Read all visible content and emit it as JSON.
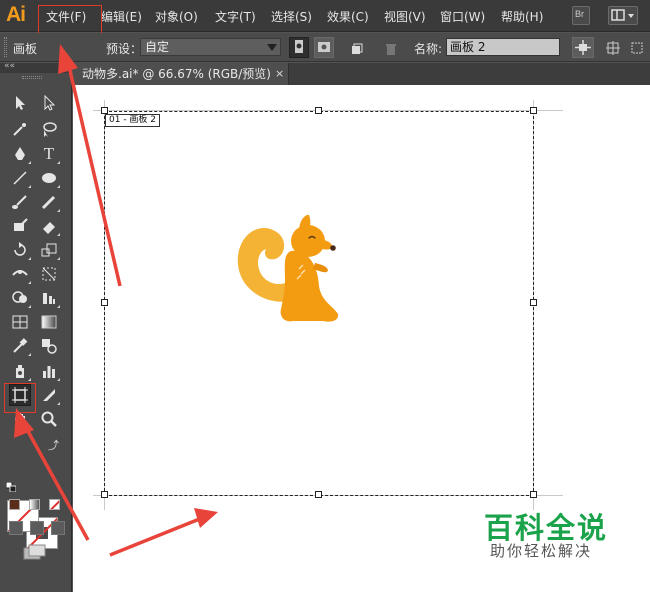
{
  "app": {
    "logo": "Ai"
  },
  "menu": {
    "items": [
      {
        "label": "文件(F)"
      },
      {
        "label": "编辑(E)"
      },
      {
        "label": "对象(O)"
      },
      {
        "label": "文字(T)"
      },
      {
        "label": "选择(S)"
      },
      {
        "label": "效果(C)"
      },
      {
        "label": "视图(V)"
      },
      {
        "label": "窗口(W)"
      },
      {
        "label": "帮助(H)"
      }
    ],
    "br_label": "Br"
  },
  "controlbar": {
    "panel_label": "画板",
    "preset_label": "预设：",
    "preset_value": "自定",
    "name_label": "名称:",
    "name_value": "画板 2"
  },
  "document": {
    "tab_title": "动物多.ai* @ 66.67% (RGB/预览)",
    "close_glyph": "×",
    "artboard_label": "01 - 画板 2"
  },
  "watermark": {
    "title": "百科全说",
    "subtitle": "助你轻松解决"
  },
  "colors": {
    "accent": "#f29b1d",
    "highlight": "#e03a2b",
    "squirrel_body": "#f39c12",
    "squirrel_tail": "#f5b335",
    "watermark_green": "#1aa34a"
  }
}
